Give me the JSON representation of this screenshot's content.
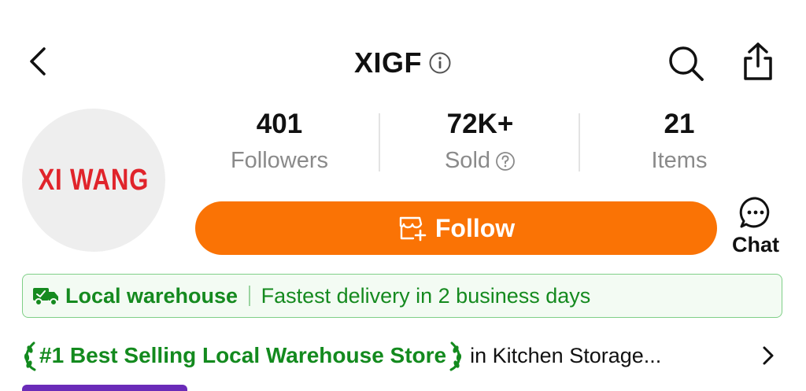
{
  "header": {
    "title": "XIGF",
    "icons": [
      "back-arrow-icon",
      "info-icon",
      "search-icon",
      "share-icon"
    ]
  },
  "avatar": {
    "text": "XI WANG"
  },
  "stats": {
    "followers": {
      "value": "401",
      "label": "Followers"
    },
    "sold": {
      "value": "72K+",
      "label": "Sold"
    },
    "items": {
      "value": "21",
      "label": "Items"
    }
  },
  "actions": {
    "follow_label": "Follow",
    "chat_label": "Chat"
  },
  "banner": {
    "warehouse_label": "Local warehouse",
    "delivery_text": "Fastest delivery in 2 business days"
  },
  "ranking": {
    "title": "#1 Best Selling Local Warehouse Store",
    "category": "in Kitchen Storage..."
  },
  "colors": {
    "accent": "#fa7305",
    "green": "#138a1e",
    "avatar_text": "#e0242b"
  }
}
